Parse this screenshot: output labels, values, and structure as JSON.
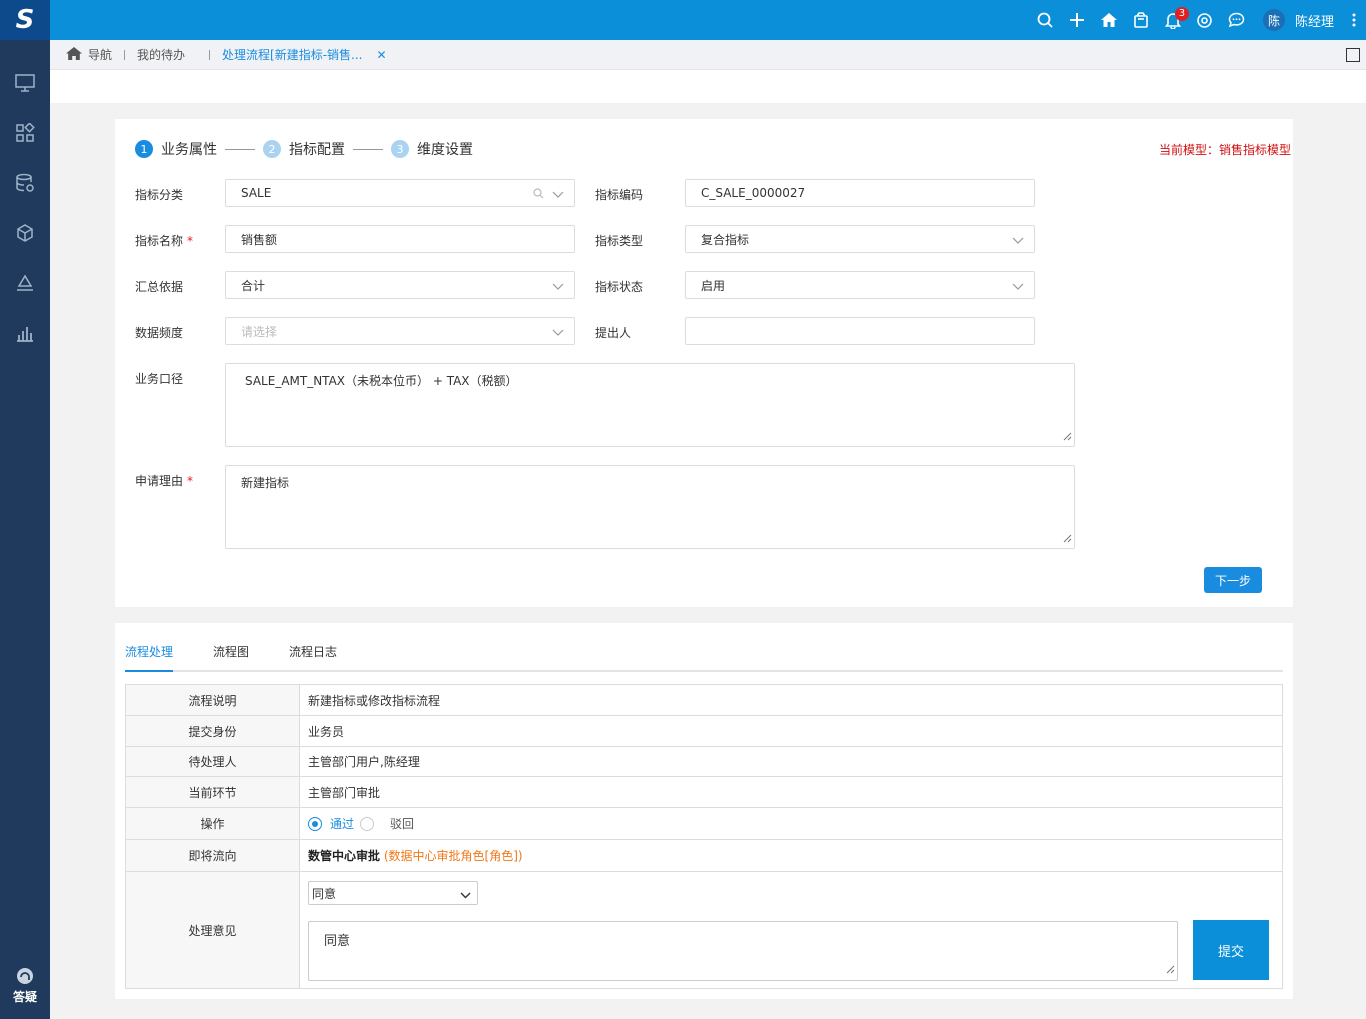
{
  "topbar": {
    "logo_text": "S",
    "notification_count": "3",
    "avatar_text": "陈",
    "username": "陈经理",
    "accent_color": "#0a8fd8",
    "icons": [
      "search-icon",
      "plus-icon",
      "home-icon",
      "bag-icon",
      "bell-icon",
      "settings-icon",
      "chat-icon",
      "more-icon"
    ]
  },
  "sidebar": {
    "icons": [
      "monitor-icon",
      "apps-icon",
      "database-icon",
      "cube-icon",
      "layers-icon",
      "chart-icon"
    ],
    "bottom_label": "答疑"
  },
  "tabs": {
    "nav": "导航",
    "todo": "我的待办",
    "active": "处理流程[新建指标-销售..."
  },
  "steps": [
    {
      "num": "1",
      "label": "业务属性"
    },
    {
      "num": "2",
      "label": "指标配置"
    },
    {
      "num": "3",
      "label": "维度设置"
    }
  ],
  "model_info": "当前模型：销售指标模型",
  "form": {
    "category_label": "指标分类",
    "category_value": "SALE",
    "code_label": "指标编码",
    "code_value": "C_SALE_0000027",
    "name_label": "指标名称",
    "name_value": "销售额",
    "type_label": "指标类型",
    "type_value": "复合指标",
    "agg_label": "汇总依据",
    "agg_value": "合计",
    "status_label": "指标状态",
    "status_value": "启用",
    "freq_label": "数据频度",
    "freq_placeholder": "请选择",
    "proposer_label": "提出人",
    "proposer_value": "",
    "caliber_label": "业务口径",
    "caliber_value": "SALE_AMT_NTAX（未税本位币） + TAX（税额）",
    "reason_label": "申请理由",
    "reason_value": "新建指标",
    "required_mark": "*",
    "next_button": "下一步"
  },
  "process": {
    "tabs": [
      "流程处理",
      "流程图",
      "流程日志"
    ],
    "rows": {
      "desc_key": "流程说明",
      "desc_val": "新建指标或修改指标流程",
      "identity_key": "提交身份",
      "identity_val": "业务员",
      "pending_key": "待处理人",
      "pending_val": "主管部门用户,陈经理",
      "current_key": "当前环节",
      "current_val": "主管部门审批",
      "action_key": "操作",
      "action_pass": "通过",
      "action_reject": "驳回",
      "next_key": "即将流向",
      "next_node": "数管中心审批",
      "next_role": "(数据中心审批角色[角色])",
      "opinion_key": "处理意见",
      "opinion_select": "同意",
      "opinion_text": "同意",
      "submit": "提交"
    }
  }
}
